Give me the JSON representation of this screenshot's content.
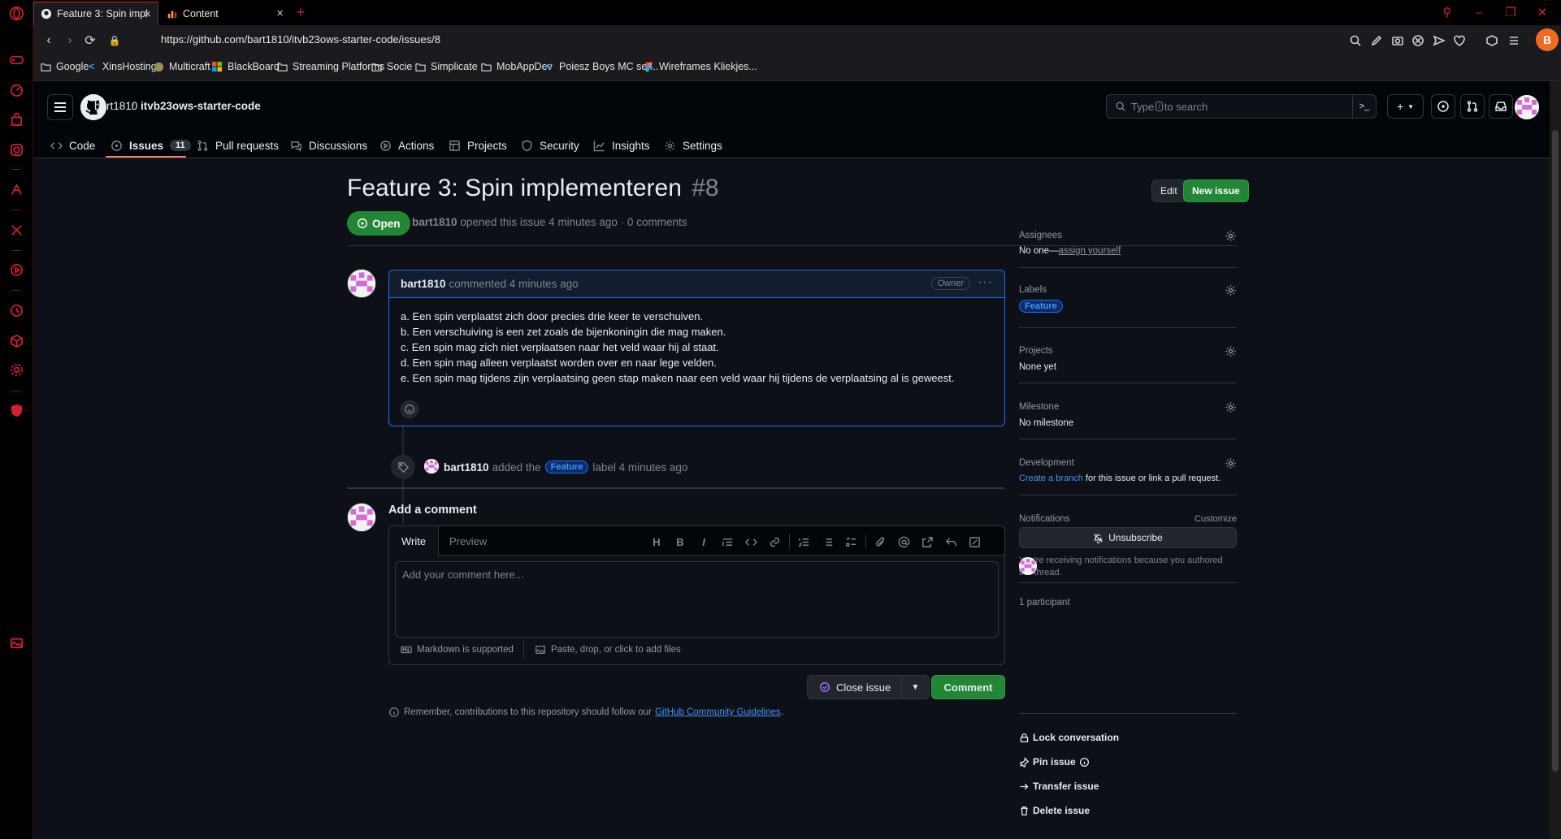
{
  "browser": {
    "tabs": [
      {
        "title": "Feature 3: Spin implementeren",
        "active": true
      },
      {
        "title": "Content",
        "active": false
      }
    ],
    "url": "https://github.com/bart1810/itvb23ows-starter-code/issues/8",
    "profile_initial": "B",
    "accent_color": "#d2202f",
    "bookmarks": [
      {
        "label": "Google",
        "icon": "google-icon"
      },
      {
        "label": "XinsHosting",
        "icon": "xins-icon"
      },
      {
        "label": "Multicraft",
        "icon": "multicraft-icon"
      },
      {
        "label": "BlackBoard",
        "icon": "windows-icon"
      },
      {
        "label": "Streaming Platforms",
        "icon": "folder-icon"
      },
      {
        "label": "Socie",
        "icon": "folder-icon"
      },
      {
        "label": "Simplicate",
        "icon": "folder-icon"
      },
      {
        "label": "MobAppDev",
        "icon": "folder-icon"
      },
      {
        "label": "Poiesz Boys MC ser...",
        "icon": "xins-icon"
      },
      {
        "label": "Wireframes Kliekjes...",
        "icon": "figma-icon"
      }
    ]
  },
  "github": {
    "owner": "bart1810",
    "separator": "/",
    "repo": "itvb23ows-starter-code",
    "search_placeholder_before": "Type",
    "search_key": "/",
    "search_placeholder_after": "to search",
    "repo_tabs": [
      {
        "label": "Code",
        "icon": "code-icon"
      },
      {
        "label": "Issues",
        "icon": "issue-opened-icon",
        "count": "11",
        "selected": true
      },
      {
        "label": "Pull requests",
        "icon": "git-pull-request-icon"
      },
      {
        "label": "Discussions",
        "icon": "comment-discussion-icon"
      },
      {
        "label": "Actions",
        "icon": "play-icon"
      },
      {
        "label": "Projects",
        "icon": "table-icon"
      },
      {
        "label": "Security",
        "icon": "shield-icon"
      },
      {
        "label": "Insights",
        "icon": "graph-icon"
      },
      {
        "label": "Settings",
        "icon": "gear-icon"
      }
    ]
  },
  "issue": {
    "title": "Feature 3: Spin implementeren",
    "number": "#8",
    "edit_label": "Edit",
    "new_issue_label": "New issue",
    "state": "Open",
    "author": "bart1810",
    "meta_text": "opened this issue 4 minutes ago · 0 comments",
    "comment": {
      "author": "bart1810",
      "action": "commented 4 minutes ago",
      "badge": "Owner",
      "lines": [
        "a. Een spin verplaatst zich door precies drie keer te verschuiven.",
        "b. Een verschuiving is een zet zoals de bijenkoningin die mag maken.",
        "c. Een spin mag zich niet verplaatsen naar het veld waar hij al staat.",
        "d. Een spin mag alleen verplaatst worden over en naar lege velden.",
        "e. Een spin mag tijdens zijn verplaatsing geen stap maken naar een veld waar hij tijdens de verplaatsing al is geweest."
      ]
    },
    "event": {
      "author": "bart1810",
      "before": "added the",
      "label": "Feature",
      "after": "label 4 minutes ago"
    }
  },
  "new_comment": {
    "title": "Add a comment",
    "tab_write": "Write",
    "tab_preview": "Preview",
    "placeholder": "Add your comment here...",
    "markdown_note": "Markdown is supported",
    "files_note": "Paste, drop, or click to add files",
    "close_label": "Close issue",
    "comment_label": "Comment",
    "guidelines_before": "Remember, contributions to this repository should follow our",
    "guidelines_link": "GitHub Community Guidelines",
    "guidelines_after": "."
  },
  "sidebar": {
    "assignees_title": "Assignees",
    "assignees_value": "No one—",
    "assign_yourself": "assign yourself",
    "labels_title": "Labels",
    "label": "Feature",
    "projects_title": "Projects",
    "projects_value": "None yet",
    "milestone_title": "Milestone",
    "milestone_value": "No milestone",
    "development_title": "Development",
    "development_link": "Create a branch",
    "development_rest": "for this issue or link a pull request.",
    "notifications_title": "Notifications",
    "customize": "Customize",
    "unsubscribe": "Unsubscribe",
    "notification_reason": "You're receiving notifications because you authored the thread.",
    "participants": "1 participant",
    "lock": "Lock conversation",
    "pin": "Pin issue",
    "transfer": "Transfer issue",
    "delete": "Delete issue"
  }
}
